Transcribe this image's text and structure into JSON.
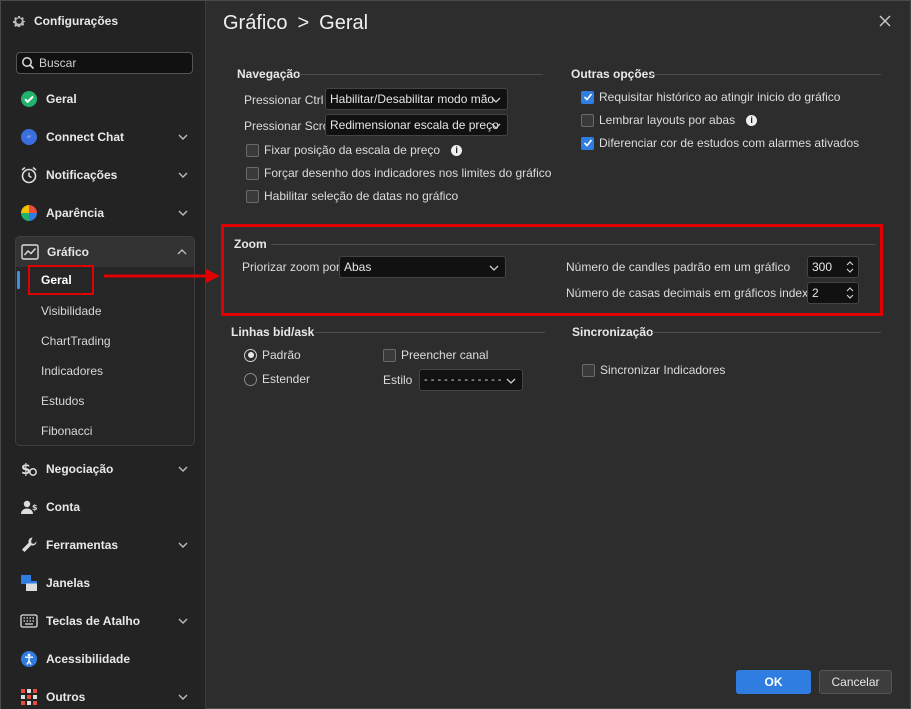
{
  "sidebar": {
    "title": "Configurações",
    "search_placeholder": "Buscar",
    "items": [
      {
        "label": "Geral",
        "icon": "check-circle-icon"
      },
      {
        "label": "Connect Chat",
        "icon": "chat-icon"
      },
      {
        "label": "Notificações",
        "icon": "alarm-clock-icon"
      },
      {
        "label": "Aparência",
        "icon": "color-wheel-icon"
      },
      {
        "label": "Gráfico",
        "icon": "chart-icon"
      },
      {
        "label": "Negociação",
        "icon": "dollar-gear-icon"
      },
      {
        "label": "Conta",
        "icon": "user-icon"
      },
      {
        "label": "Ferramentas",
        "icon": "wrench-icon"
      },
      {
        "label": "Janelas",
        "icon": "windows-icon"
      },
      {
        "label": "Teclas de Atalho",
        "icon": "keyboard-icon"
      },
      {
        "label": "Acessibilidade",
        "icon": "accessibility-icon"
      },
      {
        "label": "Outros",
        "icon": "grid-icon"
      }
    ],
    "grafico_subitems": [
      "Geral",
      "Visibilidade",
      "ChartTrading",
      "Indicadores",
      "Estudos",
      "Fibonacci"
    ]
  },
  "header": {
    "crumb_parent": "Gráfico",
    "crumb_sep": ">",
    "crumb_current": "Geral"
  },
  "navegacao": {
    "title": "Navegação",
    "ctrl_label": "Pressionar Ctrl",
    "ctrl_value": "Habilitar/Desabilitar modo mão",
    "scroll_label": "Pressionar Scroll",
    "scroll_value": "Redimensionar escala de preço",
    "checks": [
      {
        "label": "Fixar posição da escala de preço",
        "checked": false
      },
      {
        "label": "Forçar desenho dos indicadores nos limites do gráfico",
        "checked": false
      },
      {
        "label": "Habilitar seleção de datas no gráfico",
        "checked": false
      }
    ]
  },
  "outras": {
    "title": "Outras opções",
    "checks": [
      {
        "label": "Requisitar histórico ao atingir inicio do gráfico",
        "checked": true
      },
      {
        "label": "Lembrar layouts por abas",
        "checked": false
      },
      {
        "label": "Diferenciar cor de estudos com alarmes ativados",
        "checked": true
      }
    ]
  },
  "zoom": {
    "title": "Zoom",
    "priorizar_label": "Priorizar zoom por",
    "priorizar_value": "Abas",
    "candles_label": "Número de candles padrão em um gráfico",
    "candles_value": "300",
    "decimais_label": "Número de casas decimais em gráficos indexados",
    "decimais_value": "2"
  },
  "bidask": {
    "title": "Linhas bid/ask",
    "radio_padrao": "Padrão",
    "radio_estender": "Estender",
    "preencher_label": "Preencher canal",
    "estilo_label": "Estilo",
    "estilo_value": "- - - - - - - - - - - -"
  },
  "sincronizacao": {
    "title": "Sincronização",
    "sync_label": "Sincronizar Indicadores"
  },
  "buttons": {
    "ok": "OK",
    "cancel": "Cancelar"
  },
  "colors": {
    "accent": "#2f7de1",
    "highlight": "#e00000"
  }
}
